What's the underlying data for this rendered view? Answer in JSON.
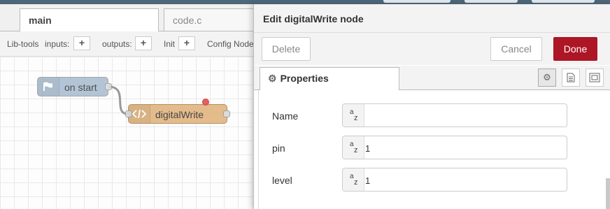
{
  "workspace": {
    "tabs": [
      {
        "label": "main"
      },
      {
        "label": "code.c"
      }
    ],
    "palette": {
      "lib_tools_label": "Lib-tools",
      "inputs_label": "inputs:",
      "outputs_label": "outputs:",
      "init_label": "Init",
      "config_label": "Config Node",
      "add_symbol": "+"
    },
    "nodes": [
      {
        "label": "on start",
        "icon": "flag-icon"
      },
      {
        "label": "digitalWrite",
        "icon": "code-icon"
      }
    ]
  },
  "tray": {
    "title": "Edit digitalWrite node",
    "buttons": {
      "delete": "Delete",
      "cancel": "Cancel",
      "done": "Done"
    },
    "tab_label": "Properties",
    "fields": [
      {
        "label": "Name",
        "value": ""
      },
      {
        "label": "pin",
        "value": "1"
      },
      {
        "label": "level",
        "value": "1"
      }
    ],
    "type_badge_a": "a",
    "type_badge_z": "z"
  },
  "colors": {
    "accent": "#ad1625",
    "topbar": "#4d6678",
    "inject_node": "#a6bbcf",
    "function_node": "#e2b47f"
  }
}
